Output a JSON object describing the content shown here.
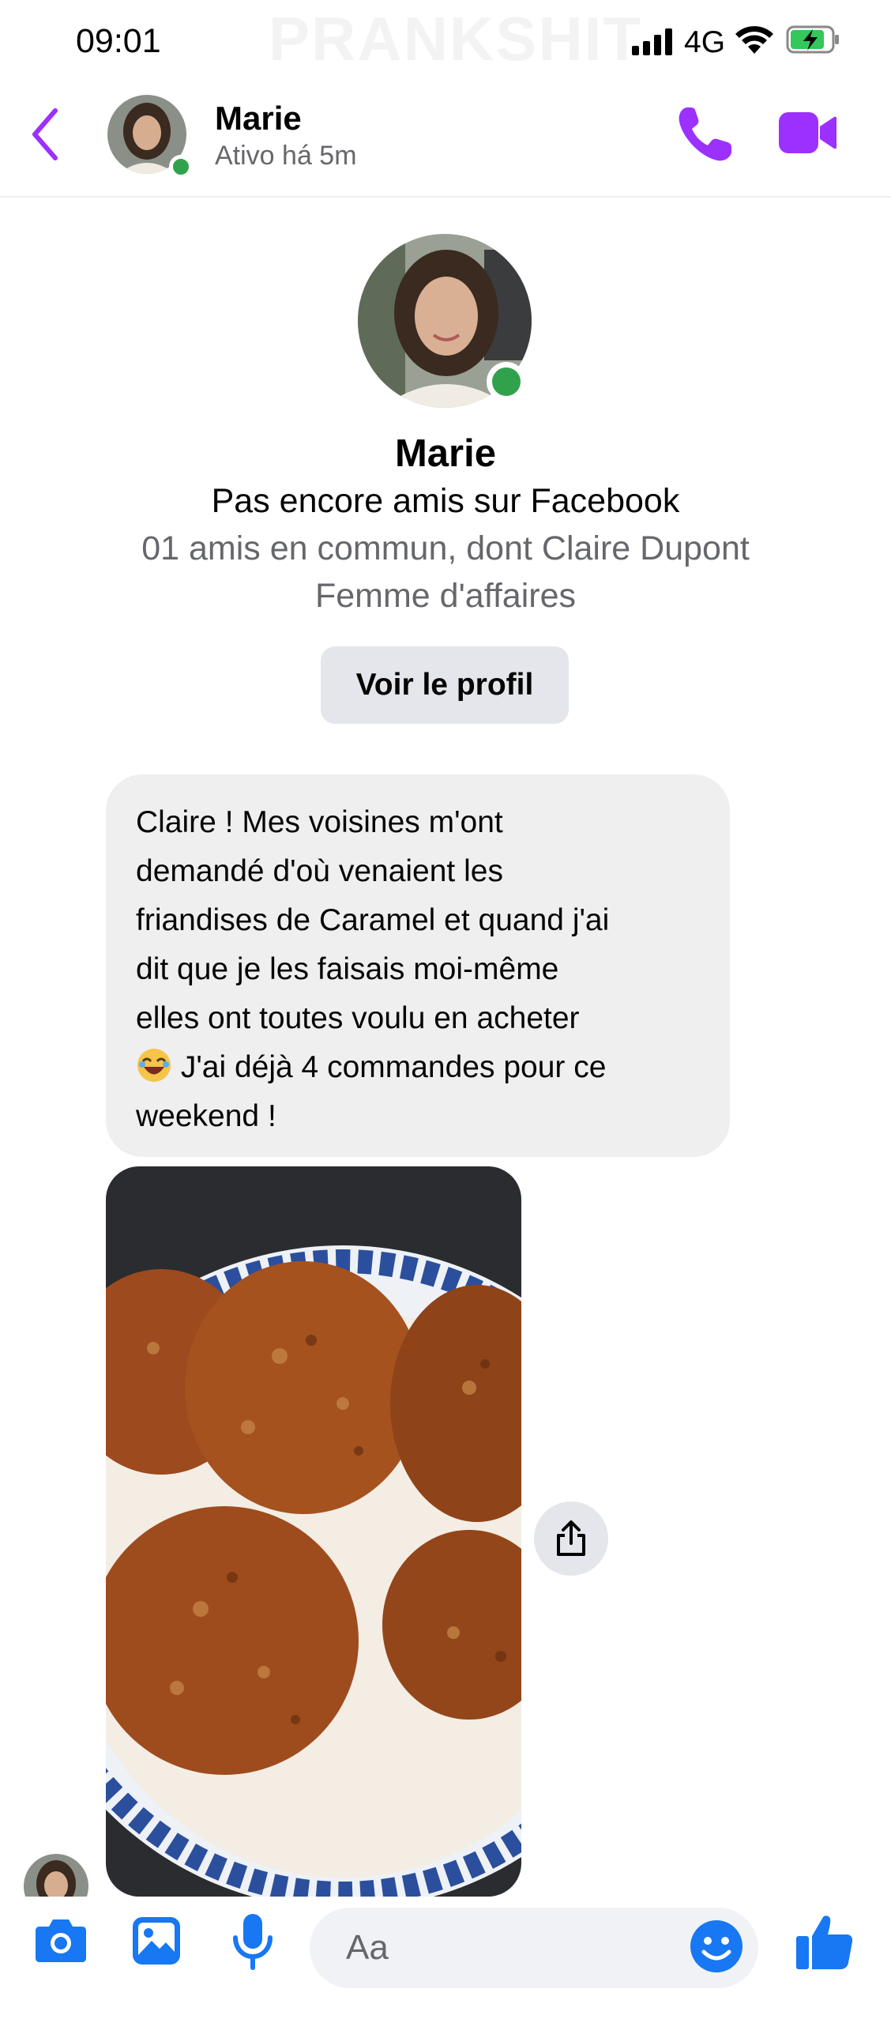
{
  "status_bar": {
    "time": "09:01",
    "network": "4G",
    "watermark": "PRANKSHIT"
  },
  "header": {
    "name": "Marie",
    "status": "Ativo há 5m"
  },
  "profile": {
    "name": "Marie",
    "friend_status": "Pas encore amis sur Facebook",
    "mutual": "01 amis en commun, dont Claire Dupont",
    "job": "Femme d'affaires",
    "button_label": "Voir le profil"
  },
  "messages": [
    {
      "text_before_emoji": "Claire ! Mes voisines m'ont\ndemandé d'où venaient les\nfriandises de Caramel et quand j'ai\ndit que je les faisais moi-même\nelles ont toutes voulu en acheter\n",
      "text_after_emoji": " J'ai déjà 4 commandes pour ce\nweekend !"
    }
  ],
  "composer": {
    "placeholder": "Aa"
  },
  "colors": {
    "accent": "#9b30ff",
    "fb_blue": "#1877f2",
    "online": "#31a24c"
  }
}
